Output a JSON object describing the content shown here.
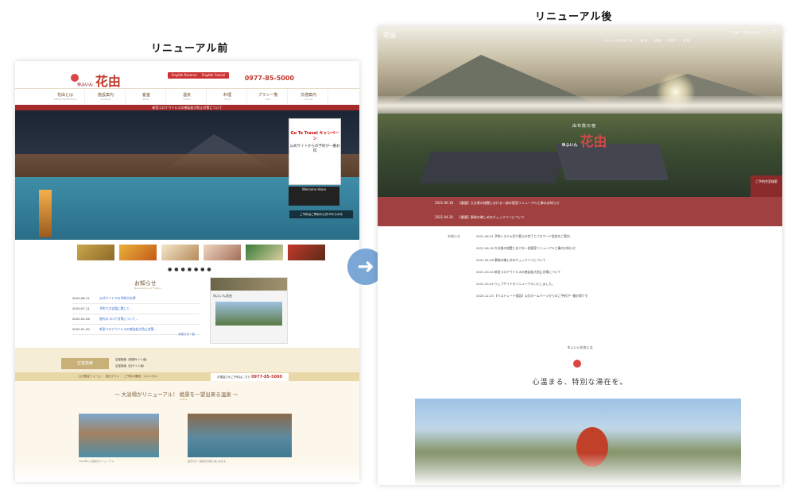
{
  "captions": {
    "before": "リニューアル前",
    "after": "リニューアル後"
  },
  "before": {
    "logo": "花由",
    "logo_small": "ゆふいん",
    "btn_english_reserve": "English Reserve",
    "btn_english_cancel": "English Cancel",
    "phone": "0977-85-5000",
    "nav": [
      {
        "label": "花由とは",
        "sub": "ABOUT HANAYOSHI"
      },
      {
        "label": "施設案内",
        "sub": "Facilities"
      },
      {
        "label": "客室",
        "sub": "Room"
      },
      {
        "label": "温泉",
        "sub": "Onsen"
      },
      {
        "label": "料理",
        "sub": "Food"
      },
      {
        "label": "プラン一覧",
        "sub": "Plan"
      },
      {
        "label": "交通案内",
        "sub": "Access"
      }
    ],
    "alert": "新型コロナウイルスの感染拡大防止対策について",
    "goto_title": "Go To Travel キャンペーン",
    "goto_sub": "公式サイトからの予約が一番お得",
    "welcome": "Welcome Hana",
    "reserve_bar": "ご予約はご専用の公式HPからのみ",
    "dots": "●●●●●●●",
    "news_title": "お知らせ",
    "news_sub": "News Notice of Todays",
    "news": [
      {
        "date": "2020.08.11",
        "text": "公式サイトでの予約がお得"
      },
      {
        "date": "2020.07.11",
        "text": "予約で大浴場に関して..."
      },
      {
        "date": "2020.05.28",
        "text": "館内のコロナ対策について..."
      },
      {
        "date": "2020.01.30",
        "text": "新型コロナウイルスの感染拡大防止対策..."
      }
    ],
    "news_more": "お知らせ一覧",
    "fb_name": "ゆふいん花由",
    "search_label": "空室検索",
    "search_opts": [
      "空室検索（新規サイト版）",
      "空室検索（旧サイト版）",
      "Reserve",
      "Cancel"
    ],
    "search_bar": "公式限定フォーム ｜ 宿泊プラン ｜ ご予約の確認・キャンセル",
    "search_phone_label": "お電話でのご予約はこちら",
    "search_phone": "0977-85-5000",
    "lower_title": "〜 大浴場がリニューアル！ 絶景を一望出来る温泉 〜",
    "lower_sub": "pickup",
    "lower_cap1": "2019年に大浴場がリニューアル!",
    "lower_cap2": "露天付き一般客を気軽に楽しめます。"
  },
  "after": {
    "header_logo": "花由",
    "header_links": "ご予約 ｜ お問い合わせ",
    "header_icons": "♡ f",
    "header_nav": "ゆふいん花由とは ｜ 客室 ｜ 施設 ｜ 温泉 ｜ 料理",
    "logo_tag": "由布院の宿",
    "logo": "花由",
    "logo_small": "ゆふいん",
    "reserve_label": "ご予約空室検索",
    "news_bar": [
      {
        "date": "2021.06.18",
        "text": "【重要】大分県の措置における一部の客室リニューアル工事のお知らせ"
      },
      {
        "date": "2021.04.26",
        "text": "【重要】事前の確しめのチェックインについて"
      }
    ],
    "news_label": "お知らせ",
    "news_list": [
      "2021.06.31 予約システム切り替えの完了とパスワード設定のご案内",
      "2021.06.18 大分県の措置における一部客室リニューアル工事のお知らせ",
      "2021.04.26 事前の確しめのチェックインについて",
      "2021.03.04 新型コロナウイルスの感染拡大防止対策について",
      "2021.03.04 ウェブサイトをリニューアルいたしました。",
      "2020.12.23 【ベストレート保証】公式ホームページからのご予約が一番お得です"
    ],
    "tag": "ゆふいん花由とは",
    "heading": "心温まる、特別な滞在を。"
  },
  "colors": {
    "brand_red": "#c0392b",
    "news_bar": "#a04040",
    "arrow": "#7aa7d6"
  }
}
